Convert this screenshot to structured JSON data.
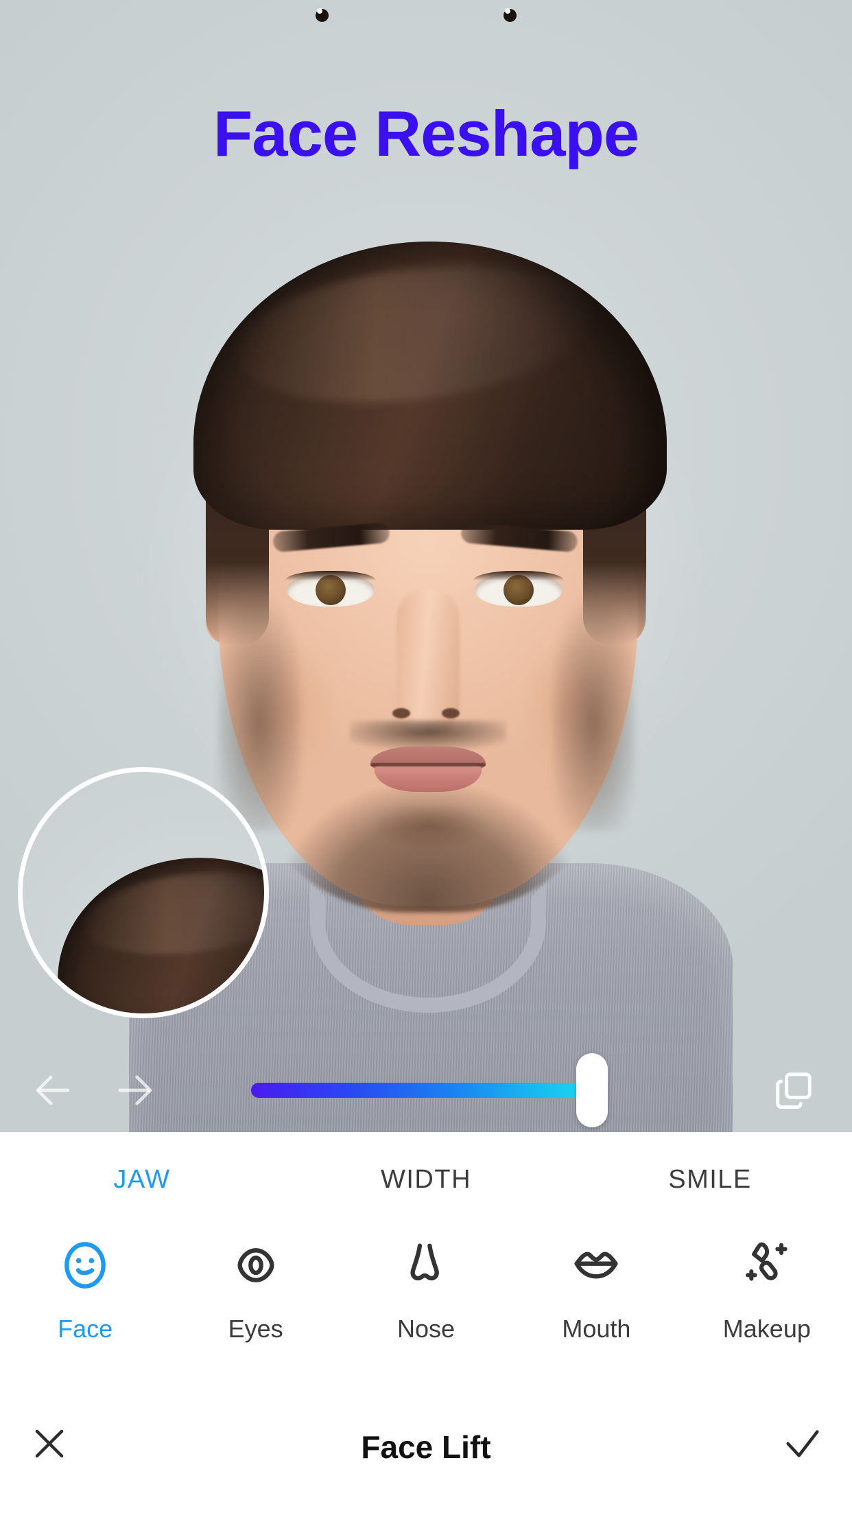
{
  "header": {
    "title": "Face Reshape",
    "title_color": "#3a0ff0"
  },
  "canvas": {
    "background_color": "#ced5d7",
    "subject": "portrait-photo",
    "preview_thumbnail": "original-face-preview"
  },
  "editor_controls": {
    "undo_icon": "arrow-left-icon",
    "redo_icon": "arrow-right-icon",
    "compare_icon": "layers-compare-icon",
    "slider": {
      "name": "intensity-slider",
      "value": 88,
      "min": 0,
      "max": 100,
      "gradient_start": "#4a1af0",
      "gradient_end": "#18d8f0",
      "thumb_color": "#ffffff"
    }
  },
  "subtabs": {
    "active_index": 0,
    "active_color": "#1e9bf0",
    "inactive_color": "#3c3c3c",
    "items": [
      {
        "label": "JAW"
      },
      {
        "label": "WIDTH"
      },
      {
        "label": "SMILE"
      }
    ]
  },
  "tools": {
    "active_index": 0,
    "active_color": "#1e9bf0",
    "inactive_color": "#3c3c3c",
    "items": [
      {
        "label": "Face",
        "icon": "face-smiley-icon"
      },
      {
        "label": "Eyes",
        "icon": "eye-icon"
      },
      {
        "label": "Nose",
        "icon": "nose-icon"
      },
      {
        "label": "Mouth",
        "icon": "lips-icon"
      },
      {
        "label": "Makeup",
        "icon": "makeup-wand-icon"
      }
    ]
  },
  "action_bar": {
    "title": "Face Lift",
    "close_icon": "close-x-icon",
    "confirm_icon": "check-icon"
  }
}
